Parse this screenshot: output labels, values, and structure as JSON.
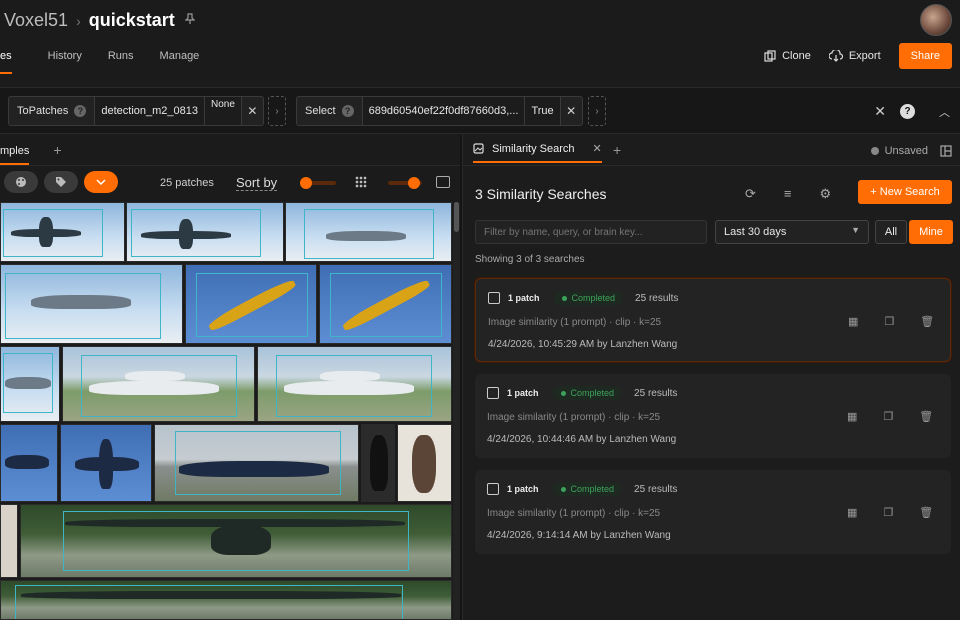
{
  "header": {
    "org": "Voxel51",
    "breadcrumb_sep": "›",
    "dataset": "quickstart",
    "pin_icon": "pin-icon",
    "nav_tabs": [
      "es",
      "History",
      "Runs",
      "Manage"
    ],
    "clone_label": "Clone",
    "export_label": "Export",
    "share_label": "Share"
  },
  "filters": {
    "stage1": {
      "name": "ToPatches",
      "param1": "detection_m2_0813",
      "param2": "None"
    },
    "stage2": {
      "name": "Select",
      "param1": "689d60540ef22f0df87660d3,...",
      "param2": "True"
    },
    "remove_symbol": "✕",
    "add_stage_symbol": "›"
  },
  "left_panel": {
    "tab_label": "mples",
    "patch_count": "25 patches",
    "sort_by": "Sort by"
  },
  "right_panel": {
    "tab_label": "Similarity Search",
    "status": "Unsaved",
    "heading": "3 Similarity Searches",
    "new_search": "+ New Search",
    "filter_placeholder": "Filter by name, query, or brain key...",
    "date_range": "Last 30 days",
    "scope_all": "All",
    "scope_mine": "Mine",
    "showing": "Showing 3 of 3 searches",
    "searches": [
      {
        "count": "1 patch",
        "status": "Completed",
        "results": "25 results",
        "desc": "Image similarity (1 prompt) · clip · k=25",
        "meta": "4/24/2026, 10:45:29 AM by Lanzhen Wang"
      },
      {
        "count": "1 patch",
        "status": "Completed",
        "results": "25 results",
        "desc": "Image similarity (1 prompt) · clip · k=25",
        "meta": "4/24/2026, 10:44:46 AM by Lanzhen Wang"
      },
      {
        "count": "1 patch",
        "status": "Completed",
        "results": "25 results",
        "desc": "Image similarity (1 prompt) · clip · k=25",
        "meta": "4/24/2026, 9:14:14 AM by Lanzhen Wang"
      }
    ]
  },
  "colors": {
    "accent": "#ff6d04",
    "success": "#3ca35a",
    "bbox": "#3fb6c8"
  }
}
